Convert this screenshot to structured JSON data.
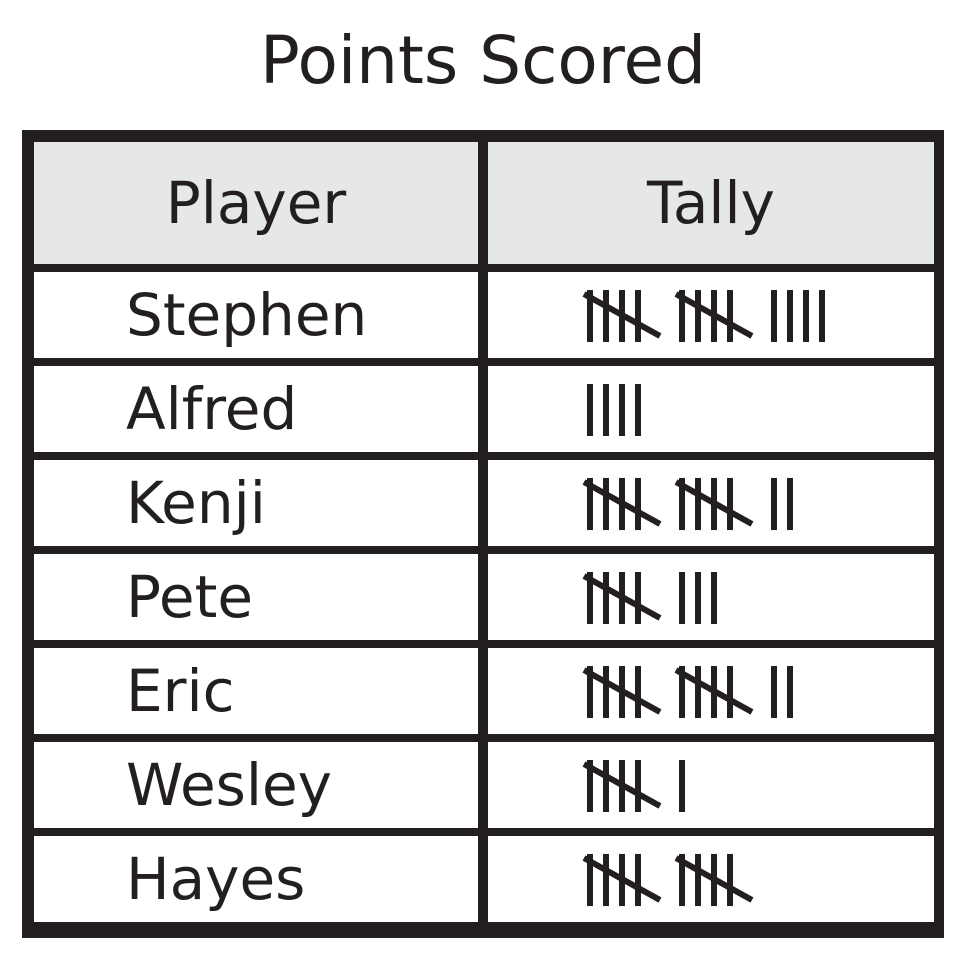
{
  "title": "Points Scored",
  "chart_data": {
    "type": "table",
    "title": "Points Scored",
    "columns": [
      "Player",
      "Tally"
    ],
    "rows": [
      {
        "player": "Stephen",
        "tally": 14
      },
      {
        "player": "Alfred",
        "tally": 4
      },
      {
        "player": "Kenji",
        "tally": 12
      },
      {
        "player": "Pete",
        "tally": 8
      },
      {
        "player": "Eric",
        "tally": 12
      },
      {
        "player": "Wesley",
        "tally": 6
      },
      {
        "player": "Hayes",
        "tally": 10
      }
    ]
  },
  "colors": {
    "ink": "#231f20",
    "header_bg": "#e6e7e8",
    "cell_bg": "#ffffff"
  }
}
